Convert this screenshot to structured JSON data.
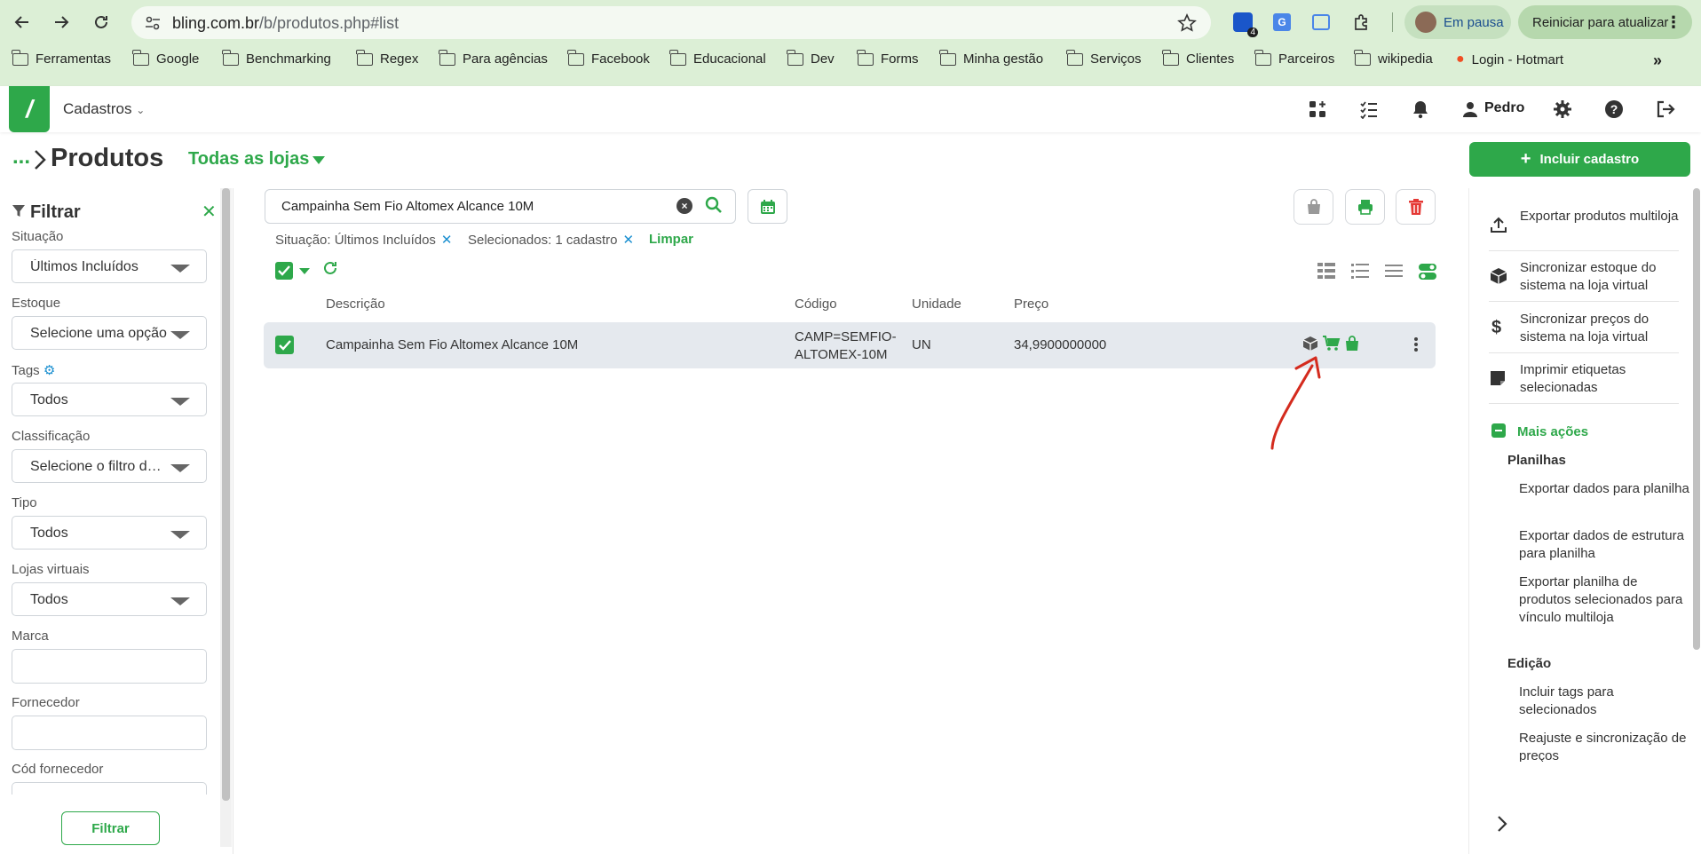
{
  "browser": {
    "url_host": "bling.com.br",
    "url_path": "/b/produtos.php#list",
    "profile_label": "Em pausa",
    "update_label": "Reiniciar para atualizar",
    "ext_badge": "4",
    "bookmarks": [
      "Ferramentas",
      "Google",
      "Benchmarking",
      "Regex",
      "Para agências",
      "Facebook",
      "Educacional",
      "Dev",
      "Forms",
      "Minha gestão",
      "Serviços",
      "Clientes",
      "Parceiros",
      "wikipedia",
      "Login - Hotmart"
    ]
  },
  "app": {
    "module": "Cadastros",
    "user": "Pedro",
    "brand_color": "#2ea84a"
  },
  "page": {
    "breadcrumb": "...",
    "title": "Produtos",
    "store_filter": "Todas as lojas",
    "include_button": "Incluir cadastro"
  },
  "filter": {
    "title": "Filtrar",
    "situacao_label": "Situação",
    "situacao_value": "Últimos Incluídos",
    "estoque_label": "Estoque",
    "estoque_value": "Selecione uma opção",
    "tags_label": "Tags",
    "tags_value": "Todos",
    "classificacao_label": "Classificação",
    "classificacao_value": "Selecione o filtro de classificação",
    "tipo_label": "Tipo",
    "tipo_value": "Todos",
    "lojas_label": "Lojas virtuais",
    "lojas_value": "Todos",
    "marca_label": "Marca",
    "fornecedor_label": "Fornecedor",
    "cod_fornecedor_label": "Cód fornecedor",
    "button": "Filtrar"
  },
  "search": {
    "value": "Campainha Sem Fio Altomex Alcance 10M"
  },
  "chips": {
    "situacao": "Situação: Últimos Incluídos",
    "selecionados": "Selecionados: 1 cadastro",
    "clear": "Limpar"
  },
  "table": {
    "headers": {
      "descricao": "Descrição",
      "codigo": "Código",
      "unidade": "Unidade",
      "preco": "Preço"
    },
    "rows": [
      {
        "descricao": "Campainha Sem Fio Altomex Alcance 10M",
        "codigo": "CAMP=SEMFIO-ALTOMEX-10M",
        "unidade": "UN",
        "preco": "34,9900000000"
      }
    ]
  },
  "actions": {
    "items": [
      "Exportar produtos multiloja",
      "Sincronizar estoque do sistema na loja virtual",
      "Sincronizar preços do sistema na loja virtual",
      "Imprimir etiquetas selecionadas"
    ],
    "more": "Mais ações",
    "planilhas_title": "Planilhas",
    "planilhas": [
      "Exportar dados para planilha",
      "Exportar dados de estrutura para planilha",
      "Exportar planilha de produtos selecionados para vínculo multiloja"
    ],
    "edicao_title": "Edição",
    "edicao": [
      "Incluir tags para selecionados",
      "Reajuste e sincronização de preços"
    ]
  }
}
